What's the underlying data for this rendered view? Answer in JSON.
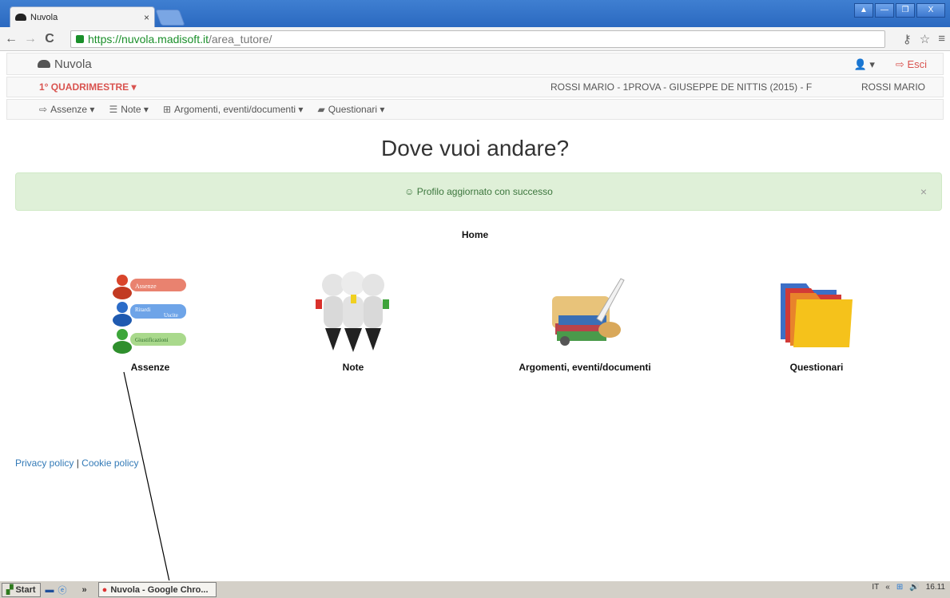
{
  "browser": {
    "tab_title": "Nuvola",
    "tab_close": "×",
    "url_scheme": "https://",
    "url_host": "nuvola.madisoft.it",
    "url_path": "/area_tutore/",
    "back": "←",
    "forward": "→",
    "reload": "C",
    "window_buttons": [
      "▲",
      "—",
      "❐",
      "X"
    ]
  },
  "app": {
    "brand": "Nuvola",
    "user_menu": "▾",
    "logout": "Esci"
  },
  "context": {
    "period": "1° QUADRIMESTRE ▾",
    "student": "ROSSI MARIO - 1PROVA - GIUSEPPE DE NITTIS (2015) - F",
    "guardian": "ROSSI MARIO"
  },
  "menu": [
    {
      "label": "Assenze",
      "icon": "sign-in-icon"
    },
    {
      "label": "Note",
      "icon": "list-icon"
    },
    {
      "label": "Argomenti, eventi/documenti",
      "icon": "table-icon"
    },
    {
      "label": "Questionari",
      "icon": "book-icon"
    }
  ],
  "page": {
    "title": "Dove vuoi andare?",
    "alert": "☺ Profilo aggiornato con successo",
    "alert_close": "×",
    "breadcrumb": "Home"
  },
  "tiles": [
    {
      "label": "Assenze",
      "icon": "assenze-ritardi-giustificazioni-icon",
      "lines": [
        "Assenze",
        "Ritardi",
        "Uscite",
        "Giustificazioni"
      ]
    },
    {
      "label": "Note",
      "icon": "notes-people-icon"
    },
    {
      "label": "Argomenti, eventi/documenti",
      "icon": "scrolls-quill-icon"
    },
    {
      "label": "Questionari",
      "icon": "folders-icon"
    }
  ],
  "footer": {
    "privacy": "Privacy policy",
    "separator": " | ",
    "cookie": "Cookie policy"
  },
  "taskbar": {
    "start": "Start",
    "chevron": "»",
    "active_app": "Nuvola - Google Chro...",
    "lang": "IT",
    "tray_chevron": "«",
    "clock": "16.11"
  }
}
